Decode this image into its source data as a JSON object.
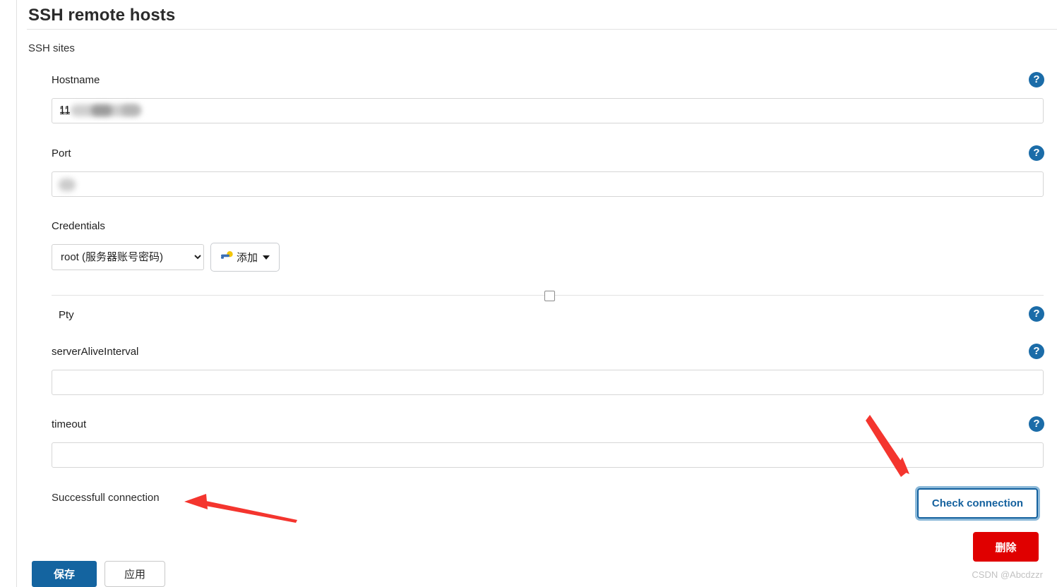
{
  "page": {
    "title": "SSH remote hosts",
    "section_label": "SSH sites",
    "watermark": "CSDN @Abcdzzr"
  },
  "fields": {
    "hostname": {
      "label": "Hostname",
      "value": "11",
      "redacted": true,
      "help_icon": "?"
    },
    "port": {
      "label": "Port",
      "value": "",
      "redacted": true,
      "help_icon": "?"
    },
    "credentials": {
      "label": "Credentials",
      "selected": "root (服务器账号密码)",
      "options": [
        "root (服务器账号密码)"
      ],
      "add_button_label": "添加",
      "add_button_icon": "key-icon"
    },
    "pty": {
      "label": "Pty",
      "checked": false,
      "help_icon": "?"
    },
    "serverAliveInterval": {
      "label": "serverAliveInterval",
      "value": "",
      "help_icon": "?"
    },
    "timeout": {
      "label": "timeout",
      "value": "",
      "help_icon": "?"
    }
  },
  "status": {
    "connection_message": "Successfull connection"
  },
  "actions": {
    "check_connection": "Check connection",
    "delete": "删除",
    "save": "保存",
    "apply": "应用"
  },
  "colors": {
    "accent_blue": "#1464a0",
    "link_blue": "#14619e",
    "help_blue": "#1b6ca8",
    "danger_red": "#e00000",
    "annotation_red": "#f4352e",
    "focus_ring": "#8cb9d9"
  }
}
